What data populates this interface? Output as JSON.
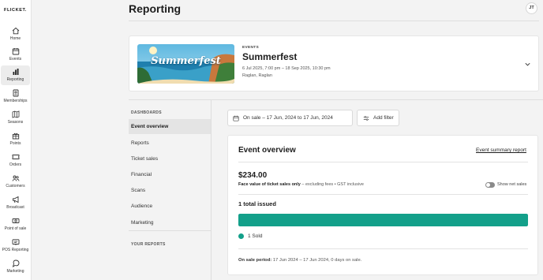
{
  "brand": "FLICKET.",
  "nav": [
    {
      "label": "Home",
      "icon": "home-icon"
    },
    {
      "label": "Events",
      "icon": "calendar-icon"
    },
    {
      "label": "Reporting",
      "icon": "bar-chart-icon",
      "active": true
    },
    {
      "label": "Memberships",
      "icon": "id-card-icon"
    },
    {
      "label": "Seasons",
      "icon": "map-icon"
    },
    {
      "label": "Points",
      "icon": "gift-icon"
    },
    {
      "label": "Orders",
      "icon": "ticket-icon"
    },
    {
      "label": "Customers",
      "icon": "users-icon"
    },
    {
      "label": "Broadcast",
      "icon": "megaphone-icon"
    },
    {
      "label": "Point of sale",
      "icon": "cash-icon"
    },
    {
      "label": "POS Reporting",
      "icon": "receipt-icon"
    },
    {
      "label": "Marketing",
      "icon": "marketing-icon"
    }
  ],
  "header": {
    "title": "Reporting",
    "avatar": "JT"
  },
  "event": {
    "kicker": "EVENTS",
    "name": "Summerfest",
    "dates": "6 Jul 2025, 7:00 pm – 18 Sep 2025, 10:30 pm",
    "place": "Raglan, Raglan",
    "banner_text": "Summerfest"
  },
  "dashboards": {
    "heading": "DASHBOARDS",
    "items": [
      "Event overview",
      "Reports",
      "Ticket sales",
      "Financial",
      "Scans",
      "Audience",
      "Marketing"
    ],
    "active_index": 0,
    "your_reports_heading": "YOUR REPORTS"
  },
  "filters": {
    "date_range": "On sale – 17 Jun, 2024 to 17 Jun, 2024",
    "add_filter": "Add filter"
  },
  "overview": {
    "title": "Event overview",
    "summary_link": "Event summary report",
    "amount": "$234.00",
    "face_value_bold": "Face value of ticket sales only",
    "face_value_note": " – excluding fees • GST inclusive",
    "show_net_sales": "Show net sales",
    "issued": "1 total issued",
    "sold_fraction": 1.0,
    "legend_label": "1 Sold",
    "period_label": "On sale period:",
    "period_value": " 17 Jun 2024 – 17 Jun 2024, 0 days on sale."
  },
  "colors": {
    "accent": "#13a08a",
    "active_bg": "#e4e4e4"
  }
}
